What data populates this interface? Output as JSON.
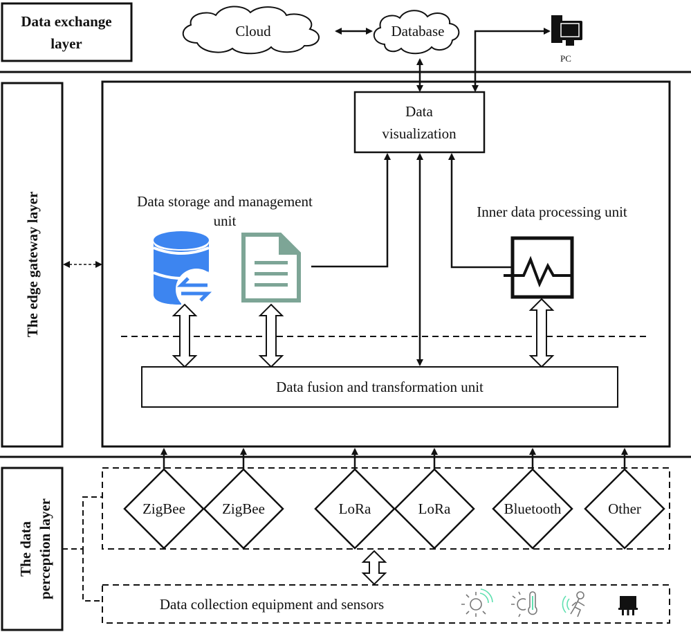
{
  "layers": {
    "exchange": {
      "line1": "Data exchange",
      "line2": "layer"
    },
    "gateway": {
      "label": "The edge gateway layer"
    },
    "perception": {
      "line1": "The data",
      "line2": "perception layer"
    }
  },
  "exchange": {
    "cloud": "Cloud",
    "database": "Database",
    "pc": "PC"
  },
  "gateway": {
    "visualization": {
      "line1": "Data",
      "line2": "visualization"
    },
    "storage": {
      "line1": "Data storage and management",
      "line2": "unit"
    },
    "inner": "Inner data processing unit",
    "fusion": "Data fusion and transformation unit"
  },
  "perception": {
    "protocols": [
      "ZigBee",
      "ZigBee",
      "LoRa",
      "LoRa",
      "Bluetooth",
      "Other"
    ],
    "equipment": "Data collection equipment and sensors",
    "sensor_icons": [
      "light-sensor-icon",
      "temperature-sensor-icon",
      "motion-sensor-icon",
      "chip-icon"
    ]
  },
  "colors": {
    "db_icon": "#3d85f0",
    "doc_icon": "#7da596",
    "sensor_accent": "#5fe0b0"
  }
}
